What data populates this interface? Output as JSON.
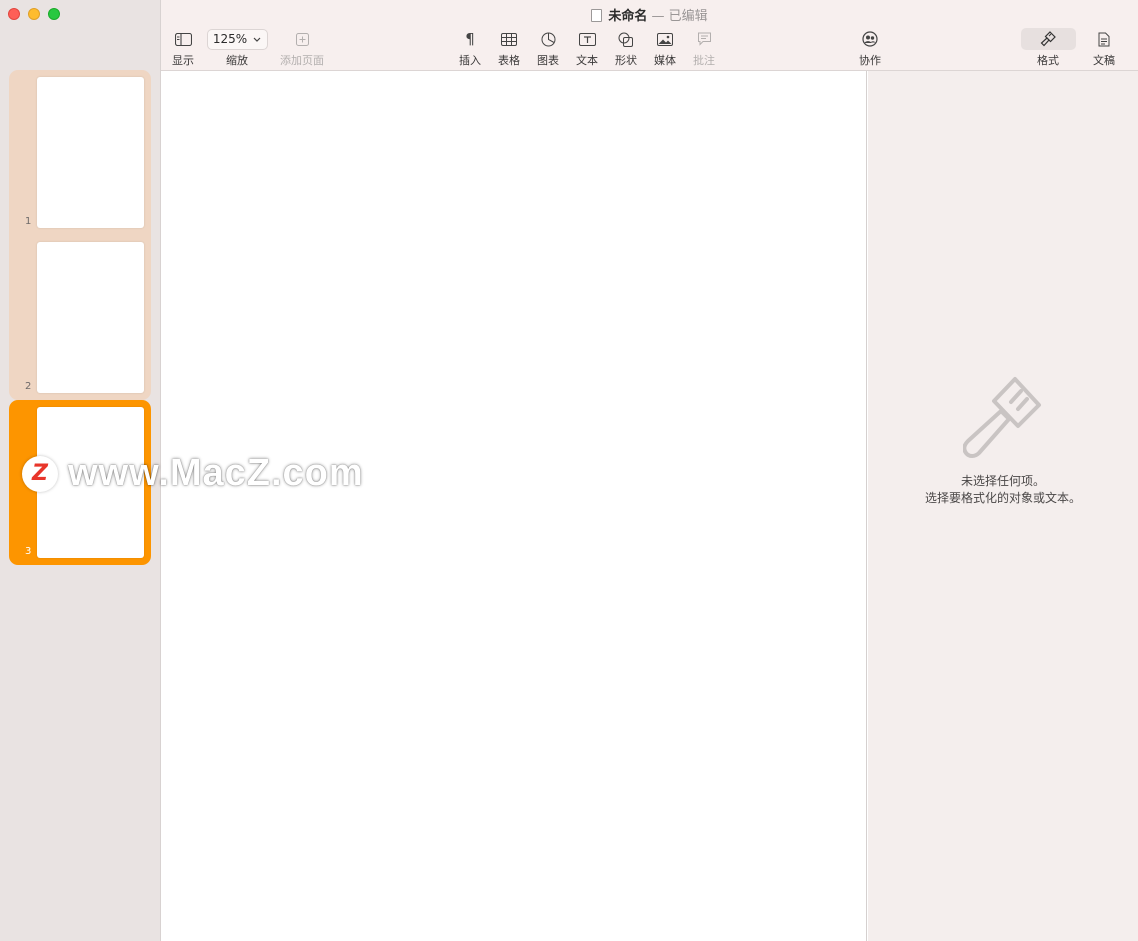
{
  "window": {
    "title": "未命名",
    "title_sep": "—",
    "title_status": "已编辑"
  },
  "toolbar": {
    "view_label": "显示",
    "zoom_value": "125%",
    "zoom_label": "缩放",
    "add_page_label": "添加页面",
    "insert_label": "插入",
    "table_label": "表格",
    "chart_label": "图表",
    "text_label": "文本",
    "shape_label": "形状",
    "media_label": "媒体",
    "comment_label": "批注",
    "collaborate_label": "协作",
    "format_label": "格式",
    "document_label": "文稿"
  },
  "sidebar": {
    "pages": [
      {
        "number": "1",
        "selected": false
      },
      {
        "number": "2",
        "selected": false
      },
      {
        "number": "3",
        "selected": true
      }
    ]
  },
  "inspector": {
    "line1": "未选择任何项。",
    "line2": "选择要格式化的对象或文本。"
  },
  "watermark": {
    "logo_letter": "Z",
    "text": "www.MacZ.com"
  },
  "colors": {
    "selected_thumb": "#fd9500",
    "group_thumb": "#efd6c3",
    "sidebar_bg": "#e9e3e2",
    "toolbar_bg": "#f7efee",
    "inspector_bg": "#f4eeed"
  }
}
